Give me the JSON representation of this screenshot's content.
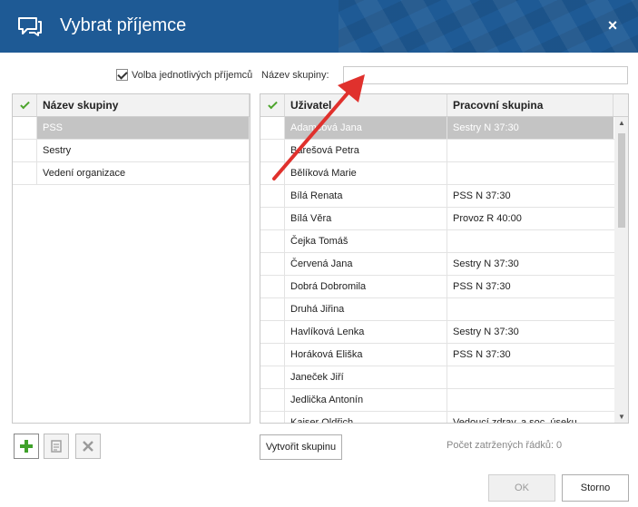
{
  "dialog": {
    "title": "Vybrat příjemce",
    "close_label": "×"
  },
  "options": {
    "individual_label": "Volba jednotlivých příjemců"
  },
  "group_name": {
    "label": "Název skupiny:",
    "value": ""
  },
  "groups_table": {
    "header": "Název skupiny",
    "rows": [
      "PSS",
      "Sestry",
      "Vedení organizace"
    ],
    "selected_index": 0
  },
  "users_table": {
    "headers": {
      "user": "Uživatel",
      "workgroup": "Pracovní skupina"
    },
    "rows": [
      {
        "user": "Adamcová Jana",
        "workgroup": "Sestry N 37:30"
      },
      {
        "user": "Barešová Petra",
        "workgroup": ""
      },
      {
        "user": "Bělíková Marie",
        "workgroup": ""
      },
      {
        "user": "Bílá Renata",
        "workgroup": "PSS N 37:30"
      },
      {
        "user": "Bílá Věra",
        "workgroup": "Provoz R 40:00"
      },
      {
        "user": "Čejka Tomáš",
        "workgroup": ""
      },
      {
        "user": "Červená Jana",
        "workgroup": "Sestry N 37:30"
      },
      {
        "user": "Dobrá Dobromila",
        "workgroup": "PSS N 37:30"
      },
      {
        "user": "Druhá Jiřina",
        "workgroup": ""
      },
      {
        "user": "Havlíková Lenka",
        "workgroup": "Sestry N 37:30"
      },
      {
        "user": "Horáková Eliška",
        "workgroup": "PSS N 37:30"
      },
      {
        "user": "Janeček Jiří",
        "workgroup": ""
      },
      {
        "user": "Jedlička Antonín",
        "workgroup": ""
      },
      {
        "user": "Kaiser Oldřich",
        "workgroup": "Vedoucí zdrav. a soc. úseku"
      }
    ],
    "selected_index": 0
  },
  "buttons": {
    "create_group": "Vytvořit skupinu",
    "ok": "OK",
    "cancel": "Storno"
  },
  "status": {
    "selected_rows": "Počet zatržených řádků: 0"
  },
  "colors": {
    "titlebar": "#1e5a95",
    "selection": "#c4c4c4",
    "check": "#4ca42c",
    "annotation": "#e0312d"
  }
}
